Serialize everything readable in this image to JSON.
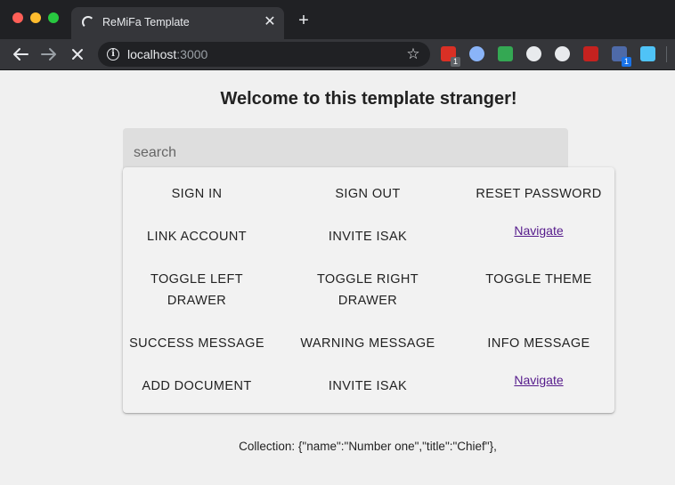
{
  "browser": {
    "tab_title": "ReMiFa Template",
    "url_host": "localhost",
    "url_port": ":3000",
    "extensions": [
      {
        "name": "red-ext-icon",
        "color": "#d93025",
        "badge": "1"
      },
      {
        "name": "blue-ring-ext-icon",
        "color": "#8ab4f8",
        "badge": ""
      },
      {
        "name": "green-plus-ext-icon",
        "color": "#34a853",
        "badge": ""
      },
      {
        "name": "braces-ext-icon",
        "color": "#e8eaed",
        "badge": ""
      },
      {
        "name": "white-circle-ext-icon",
        "color": "#e8eaed",
        "badge": ""
      },
      {
        "name": "red-square-ext-icon",
        "color": "#c5221f",
        "badge": ""
      },
      {
        "name": "folder-ext-icon",
        "color": "#4e6aa8",
        "badge": "1"
      },
      {
        "name": "blue-window-ext-icon",
        "color": "#4fc3f7",
        "badge": ""
      }
    ]
  },
  "page": {
    "heading": "Welcome to this template stranger!",
    "search_placeholder": "search",
    "buttons": {
      "sign_in": "SIGN IN",
      "sign_out": "SIGN OUT",
      "reset_password": "RESET PASSWORD",
      "link_account": "LINK ACCOUNT",
      "invite_isak": "INVITE ISAK",
      "toggle_left_drawer": "TOGGLE LEFT DRAWER",
      "toggle_right_drawer": "TOGGLE RIGHT DRAWER",
      "toggle_theme": "TOGGLE THEME",
      "success_message": "SUCCESS MESSAGE",
      "warning_message": "WARNING MESSAGE",
      "info_message": "INFO MESSAGE",
      "add_document": "ADD DOCUMENT",
      "invite_isak_2": "INVITE ISAK"
    },
    "navigate_link_1": "Navigate",
    "navigate_link_2": "Navigate",
    "collection_text": "Collection: {\"name\":\"Number one\",\"title\":\"Chief\"},"
  }
}
